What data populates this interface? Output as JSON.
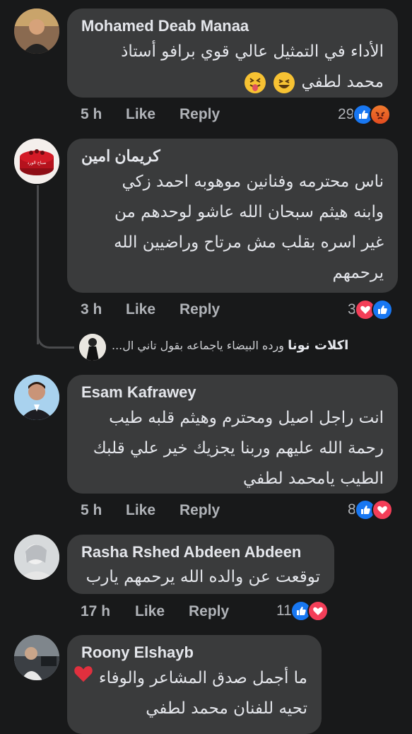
{
  "comments": [
    {
      "author": "Mohamed Deab Manaa",
      "lines": [
        "الأداء في التمثيل عالي قوي برافو أستاذ",
        "محمد لطفي"
      ],
      "time": "5 h",
      "like": "Like",
      "reply": "Reply",
      "reactions_count": "29",
      "reactions": [
        "like",
        "angry"
      ]
    },
    {
      "author": "كريمان امين",
      "lines": [
        "ناس محترمه وفنانين موهوبه احمد زكي",
        "وابنه هيثم سبحان الله عاشو لوحدهم من",
        "غير اسره بقلب مش مرتاح وراضيين الله",
        "يرحمهم"
      ],
      "time": "3 h",
      "like": "Like",
      "reply": "Reply",
      "reactions_count": "3",
      "reactions": [
        "love",
        "like"
      ],
      "reply_preview": {
        "author": "اكلات نونا",
        "text": "ورده البيضاء ياجماعه بقول تاني ال..."
      },
      "avatar_text": "صباح الورد"
    },
    {
      "author": "Esam Kafrawey",
      "lines": [
        "انت راجل اصيل ومحترم وهيثم قلبه طيب",
        "رحمة الله عليهم وربنا يجزيك خير علي قلبك",
        "الطيب يامحمد لطفي"
      ],
      "time": "5 h",
      "like": "Like",
      "reply": "Reply",
      "reactions_count": "8",
      "reactions": [
        "like",
        "love"
      ]
    },
    {
      "author": "Rasha Rshed Abdeen Abdeen",
      "lines": [
        "توقعت عن والده الله يرحمهم يارب"
      ],
      "time": "17 h",
      "like": "Like",
      "reply": "Reply",
      "reactions_count": "11",
      "reactions": [
        "like",
        "love"
      ]
    },
    {
      "author": "Roony Elshayb",
      "lines": [
        "ما أجمل صدق المشاعر والوفاء",
        "تحيه للفنان محمد لطفي"
      ]
    }
  ],
  "colors": {
    "background": "#18191a",
    "bubble": "#3a3b3c",
    "like_blue": "#1877f2",
    "love_red": "#f33e58"
  }
}
